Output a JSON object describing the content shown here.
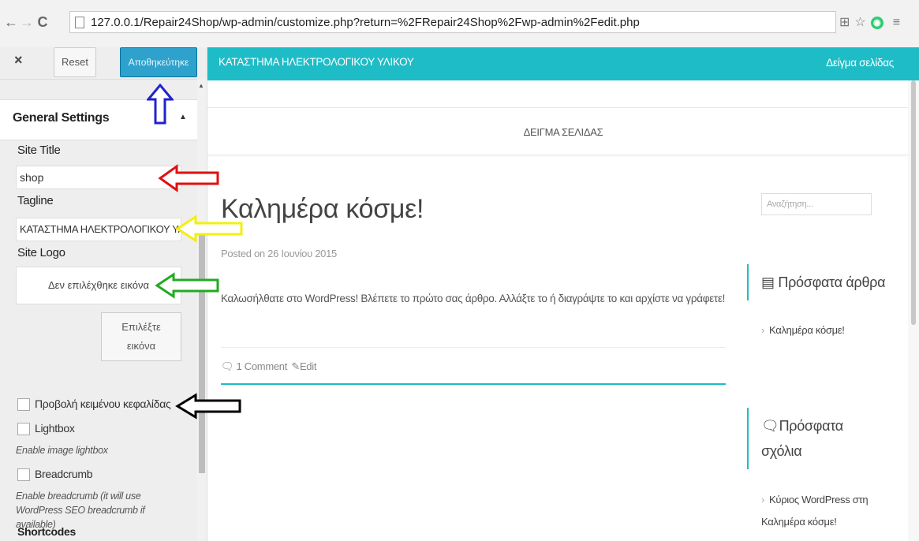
{
  "browser": {
    "url": "127.0.0.1/Repair24Shop/wp-admin/customize.php?return=%2FRepair24Shop%2Fwp-admin%2Fedit.php"
  },
  "customizer": {
    "close": "×",
    "reset_label": "Reset",
    "save_label": "Αποθηκεύτηκε",
    "section_title": "General Settings",
    "site_title_label": "Site Title",
    "site_title_value": "shop",
    "tagline_label": "Tagline",
    "tagline_value": "ΚΑΤΑΣΤΗΜΑ ΗΛΕΚΤΡΟΛΟΓΙΚΟΥ ΥΛ",
    "site_logo_label": "Site Logo",
    "no_image": "Δεν επιλέχθηκε εικόνα",
    "choose_image_line1": "Επιλέξτε",
    "choose_image_line2": "εικόνα",
    "header_text_label": "Προβολή κειμένου κεφαλίδας",
    "lightbox_label": "Lightbox",
    "lightbox_desc": "Enable image lightbox",
    "breadcrumb_label": "Breadcrumb",
    "breadcrumb_desc": "Enable breadcrumb (it will use WordPress SEO breadcrumb if available)",
    "shortcodes_label": "Shortcodes"
  },
  "preview": {
    "site_title": "ΚΑΤΑΣΤΗΜΑ ΗΛΕΚΤΡΟΛΟΓΙΚΟΥ ΥΛΙΚΟΥ",
    "menu_item": "Δείγμα σελίδας",
    "subnav": "ΔΕΙΓΜΑ ΣΕΛΙΔΑΣ",
    "post_title": "Καλημέρα κόσμε!",
    "post_meta": "Posted on 26 Ιουνίου 2015",
    "post_body": "Καλωσήλθατε στο WordPress! Βλέπετε το πρώτο σας άρθρο. Αλλάξτε το ή διαγράψτε το και αρχίστε να γράφετε!",
    "comments": "1 Comment",
    "edit": "Edit",
    "search_placeholder": "Αναζήτηση...",
    "recent_posts_title": "Πρόσφατα άρθρα",
    "recent_post_link": "Καλημέρα κόσμε!",
    "recent_comments_title_1": "Πρόσφατα",
    "recent_comments_title_2": "σχόλια",
    "recent_comment_line1": "Κύριος WordPress στη",
    "recent_comment_line2": "Καλημέρα κόσμε!"
  },
  "annotation_colors": {
    "blue": "#2222cc",
    "red": "#e01010",
    "yellow": "#f2ef10",
    "green": "#22aa22",
    "black": "#000000"
  }
}
